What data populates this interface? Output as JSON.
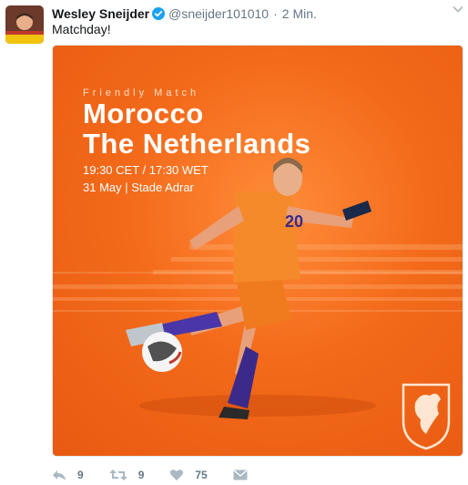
{
  "tweet": {
    "author_name": "Wesley Sneijder",
    "handle": "@sneijder101010",
    "separator": "·",
    "time": "2 Min.",
    "text": "Matchday!",
    "verified": true
  },
  "media": {
    "subtitle": "Friendly Match",
    "team_home": "Morocco",
    "team_away": "The Netherlands",
    "kickoff": "19:30 CET / 17:30 WET",
    "date_venue": "31 May | Stade Adrar",
    "shirt_number": "20"
  },
  "actions": {
    "reply_count": "9",
    "retweet_count": "9",
    "like_count": "75"
  },
  "colors": {
    "brand_orange": "#f36a1a",
    "verified_blue": "#1da1f2",
    "muted_text": "#657786"
  },
  "icons": [
    "verified-badge-icon",
    "chevron-down-icon",
    "reply-icon",
    "retweet-icon",
    "heart-icon",
    "direct-message-icon",
    "knvb-lion-crest-icon"
  ]
}
